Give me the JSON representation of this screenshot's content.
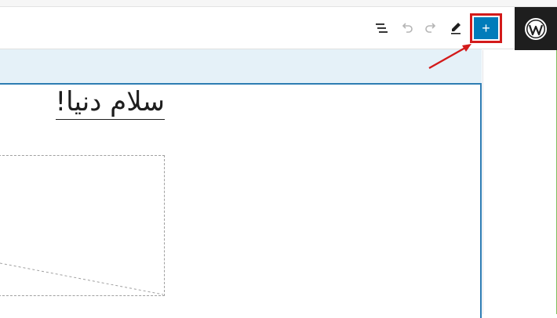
{
  "toolbar": {
    "icons": [
      "list-view-icon",
      "undo-icon",
      "redo-icon",
      "pencil-icon",
      "plus-icon"
    ],
    "add_label": "+"
  },
  "brand": {
    "icon": "wordpress-logo-icon"
  },
  "content": {
    "heading": "سلام دنیا!"
  },
  "colors": {
    "accent": "#007cba",
    "highlight": "#d31a1a",
    "dark": "#1e1e1e",
    "selection_strip": "#e5f1f8"
  }
}
